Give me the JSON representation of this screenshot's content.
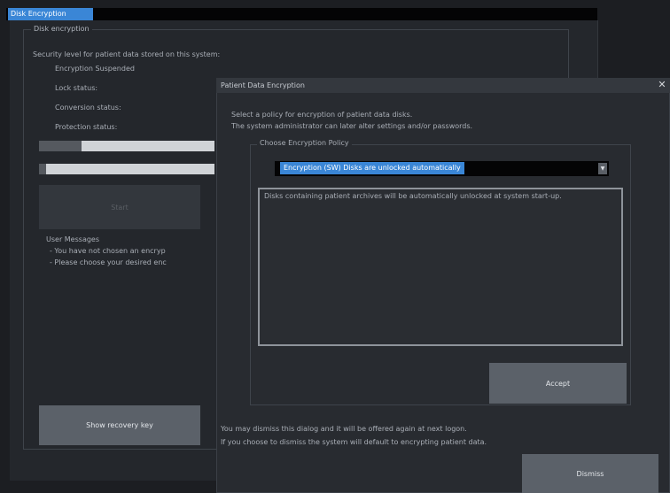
{
  "window": {
    "title": "Disk Encryption"
  },
  "disk_encryption": {
    "group_title": "Disk encryption",
    "intro": "Security level for patient data stored on this system:",
    "status_labels": [
      "Encryption Suspended",
      "Lock status:",
      "Conversion status:",
      "Protection status:"
    ],
    "progress_1": 0.24,
    "progress_2": 0.04,
    "start_label": "Start",
    "user_messages_heading": "User Messages",
    "user_messages": [
      "- You have not chosen an encryp",
      "- Please choose your desired enc"
    ],
    "recovery_key_label": "Show recovery key"
  },
  "dialog": {
    "title": "Patient Data Encryption",
    "close_icon": "x-icon",
    "intro_line1": "Select a policy for encryption of patient data disks.",
    "intro_line2": "The system administrator can later alter settings and/or passwords.",
    "policy_group_title": "Choose Encryption Policy",
    "policy_selected": "Encryption (SW) Disks are unlocked automatically",
    "policy_description": "Disks containing patient archives will be automatically unlocked at system start-up.",
    "accept_label": "Accept",
    "footer_line1": "You may dismiss this dialog and it will be offered again at next logon.",
    "footer_line2": "If you choose to dismiss the system will default to encrypting patient data.",
    "dismiss_label": "Dismiss"
  },
  "colors": {
    "accent": "#3a86d6",
    "background": "#1c1e22",
    "button": "#5b6169"
  }
}
